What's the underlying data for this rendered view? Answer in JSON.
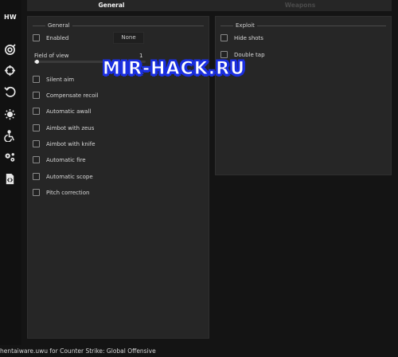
{
  "app": {
    "logo": "HW"
  },
  "sidebar": {
    "icons": [
      "target-icon",
      "crosshair-icon",
      "undo-icon",
      "sun-icon",
      "wheelchair-icon",
      "gears-icon",
      "code-file-icon"
    ]
  },
  "tabs": [
    {
      "label": "General",
      "active": true
    },
    {
      "label": "Weapons",
      "active": false
    }
  ],
  "general": {
    "title": "General",
    "enabled": {
      "label": "Enabled",
      "checked": false
    },
    "keybind": {
      "value": "None"
    },
    "fov": {
      "label": "Field of view",
      "value": "1",
      "level_percent": 2
    },
    "options": [
      {
        "label": "Silent aim",
        "checked": false
      },
      {
        "label": "Compensate recoil",
        "checked": false
      },
      {
        "label": "Automatic awall",
        "checked": false
      },
      {
        "label": "Aimbot with zeus",
        "checked": false
      },
      {
        "label": "Aimbot with knife",
        "checked": false
      },
      {
        "label": "Automatic fire",
        "checked": false
      },
      {
        "label": "Automatic scope",
        "checked": false
      },
      {
        "label": "Pitch correction",
        "checked": false
      }
    ]
  },
  "exploit": {
    "title": "Exploit",
    "options": [
      {
        "label": "Hide shots",
        "checked": false
      },
      {
        "label": "Double tap",
        "checked": false
      }
    ]
  },
  "watermark": {
    "text": "MIR-HACK.RU",
    "color": "#1a2fe0"
  },
  "footer": {
    "text": "hentaiware.uwu for Counter Strike: Global Offensive"
  },
  "colors": {
    "background": "#141414",
    "panel": "#262626",
    "text": "#d6d6d6"
  }
}
